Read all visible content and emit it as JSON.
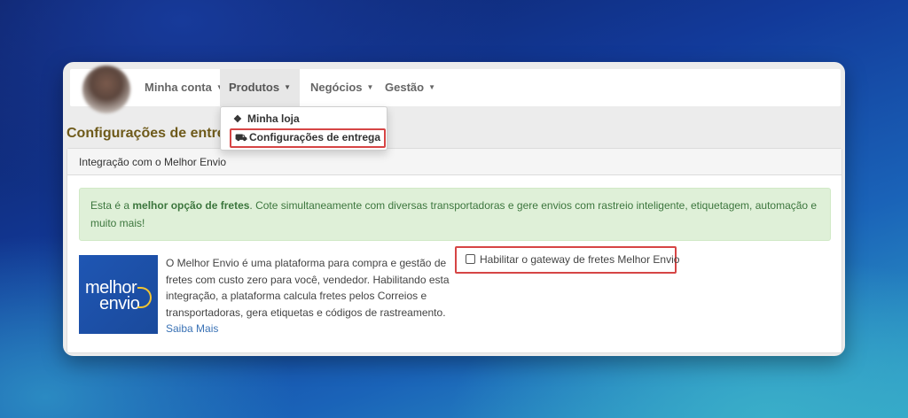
{
  "nav": {
    "items": [
      {
        "label": "Minha conta"
      },
      {
        "label": "Produtos"
      },
      {
        "label": "Negócios"
      },
      {
        "label": "Gestão"
      }
    ],
    "caret": "▼"
  },
  "dropdown": {
    "items": [
      {
        "label": "Minha loja",
        "icon": "cubes-icon"
      },
      {
        "label": "Configurações de entrega",
        "icon": "truck-icon"
      }
    ]
  },
  "page": {
    "title": "Configurações de entrega"
  },
  "panel": {
    "heading": "Integração com o Melhor Envio",
    "alert": {
      "prefix": "Esta é a ",
      "strong": "melhor opção de fretes",
      "suffix": ". Cote simultaneamente com diversas transportadoras e gere envios com rastreio inteligente, etiquetagem, automação e muito mais!"
    },
    "logo": {
      "line1": "melhor",
      "line2": "envio"
    },
    "description": "O Melhor Envio é uma plataforma para compra e gestão de fretes com custo zero para você, vendedor. Habilitando esta integração, a plataforma calcula fretes pelos Correios e transportadoras, gera etiquetas e códigos de rastreamento.",
    "more_link": "Saiba Mais",
    "gateway_label": "Habilitar o gateway de fretes Melhor Envio",
    "gateway_checked": false
  },
  "colors": {
    "title": "#6e5a1a",
    "alert_bg": "#dff0d8",
    "alert_text": "#3c763d",
    "highlight_border": "#d64545",
    "link": "#3a72b5"
  }
}
